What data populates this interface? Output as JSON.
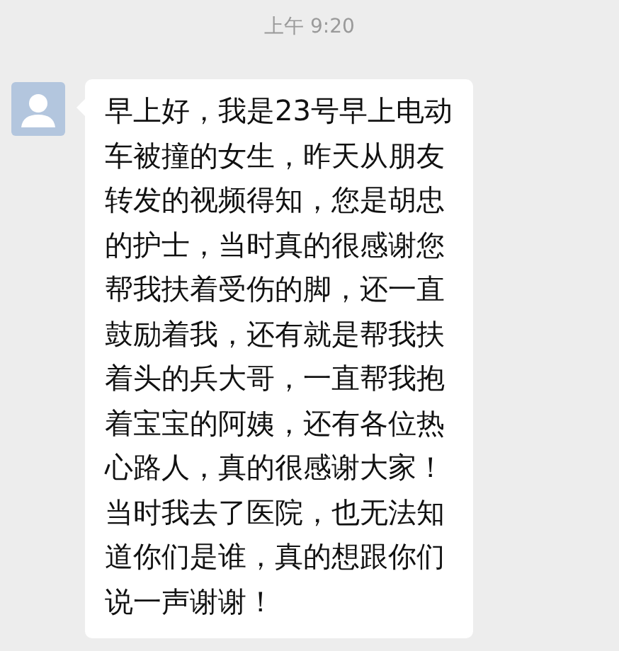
{
  "timestamp": "上午 9:20",
  "messages": [
    {
      "kind": "incoming",
      "text": "早上好，我是23号早上电动车被撞的女生，昨天从朋友转发的视频得知，您是胡忠的护士，当时真的很感谢您帮我扶着受伤的脚，还一直鼓励着我，还有就是帮我扶着头的兵大哥，一直帮我抱着宝宝的阿姨，还有各位热心路人，真的很感谢大家！当时我去了医院，也无法知道你们是谁，真的想跟你们说一声谢谢！"
    }
  ]
}
